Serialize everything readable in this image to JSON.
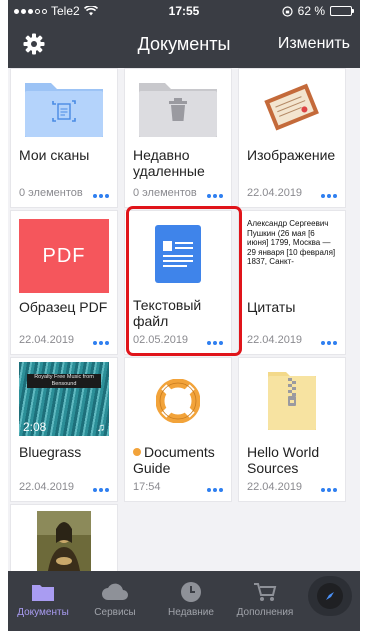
{
  "status": {
    "carrier": "Tele2",
    "time": "17:55",
    "battery": "62 %",
    "battery_level": 0.62
  },
  "nav": {
    "title": "Документы",
    "edit_label": "Изменить",
    "settings_icon": "gear-icon"
  },
  "colors": {
    "accent": "#2f7ff0",
    "highlight": "#e0141a",
    "header": "#3a3d44"
  },
  "items": [
    {
      "name": "Мои сканы",
      "meta": "0 элементов",
      "icon": "scan-folder-icon"
    },
    {
      "name": "Недавно удаленные",
      "meta": "0 элементов",
      "icon": "trash-folder-icon"
    },
    {
      "name": "Изображение",
      "meta": "22.04.2019",
      "icon": "image-thumbnail"
    },
    {
      "name": "Образец PDF",
      "meta": "22.04.2019",
      "icon": "pdf-icon",
      "thumb_text": "PDF"
    },
    {
      "name": "Текстовый файл",
      "meta": "02.05.2019",
      "icon": "text-document-icon"
    },
    {
      "name": "Цитаты",
      "meta": "22.04.2019",
      "icon": "text-preview",
      "preview": "Александр Сергеевич Пушкин (26 мая [6 июня] 1799, Москва — 29 января [10 февраля] 1837, Санкт-"
    },
    {
      "name": "Bluegrass",
      "meta": "22.04.2019",
      "icon": "video-thumbnail",
      "duration": "2:08",
      "overlay": "Royalty Free Music from Bensound"
    },
    {
      "name": "Documents Guide",
      "meta": "17:54",
      "icon": "lifebuoy-icon"
    },
    {
      "name": "Hello World Sources",
      "meta": "22.04.2019",
      "icon": "zip-archive-icon"
    },
    {
      "name": "",
      "meta": "",
      "icon": "mona-lisa-thumbnail"
    }
  ],
  "tabs": [
    {
      "label": "Документы",
      "icon": "folder-icon",
      "active": true
    },
    {
      "label": "Сервисы",
      "icon": "cloud-icon",
      "active": false
    },
    {
      "label": "Недавние",
      "icon": "clock-icon",
      "active": false
    },
    {
      "label": "Дополнения",
      "icon": "cart-icon",
      "active": false
    }
  ]
}
